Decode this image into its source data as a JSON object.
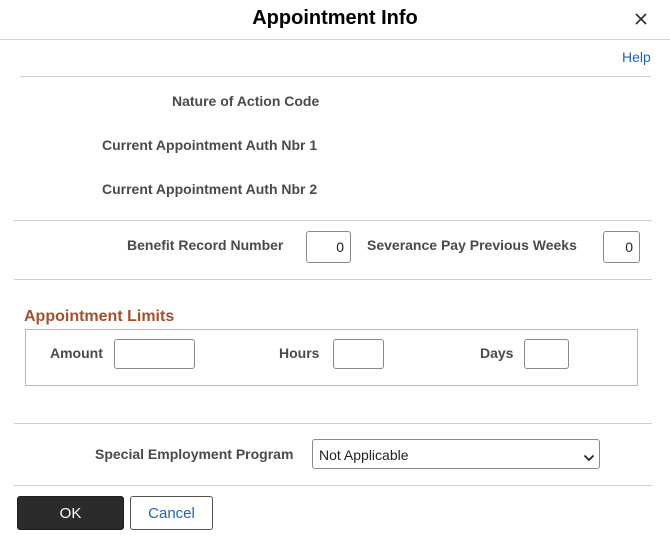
{
  "dialog": {
    "title": "Appointment Info",
    "help_link": "Help",
    "close_icon": "close-icon"
  },
  "fields": {
    "nature_of_action_code_label": "Nature of Action Code",
    "auth_nbr_1_label": "Current Appointment Auth Nbr 1",
    "auth_nbr_2_label": "Current Appointment Auth Nbr 2",
    "benefit_record_number_label": "Benefit Record Number",
    "benefit_record_number_value": "0",
    "severance_pay_weeks_label": "Severance Pay Previous Weeks",
    "severance_pay_weeks_value": "0"
  },
  "appointment_limits": {
    "title": "Appointment Limits",
    "amount_label": "Amount",
    "amount_value": "",
    "hours_label": "Hours",
    "hours_value": "",
    "days_label": "Days",
    "days_value": ""
  },
  "special_program": {
    "label": "Special Employment Program",
    "selected": "Not Applicable",
    "chevron_icon": "chevron-down-icon"
  },
  "actions": {
    "ok_label": "OK",
    "cancel_label": "Cancel"
  },
  "colors": {
    "section_title": "#a0522d",
    "link": "#2862a8",
    "primary_button": "#2b2b2b"
  }
}
